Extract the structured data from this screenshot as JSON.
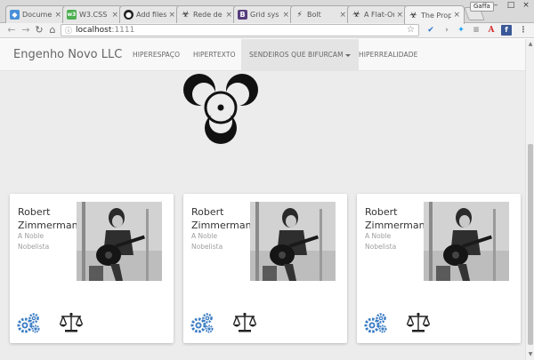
{
  "browser": {
    "tabs": [
      {
        "title": "Documen",
        "favicon_color": "#4a90d9",
        "favicon_glyph": "◆"
      },
      {
        "title": "W3.CSS",
        "favicon_color": "#4caf50",
        "favicon_glyph": "w3"
      },
      {
        "title": "Add files",
        "favicon_color": "#222222",
        "favicon_glyph": "●"
      },
      {
        "title": "Rede de",
        "favicon_color": "#555555",
        "favicon_glyph": "☣"
      },
      {
        "title": "Grid sys",
        "favicon_color": "#563d7c",
        "favicon_glyph": "B"
      },
      {
        "title": "Bolt",
        "favicon_color": "#333333",
        "favicon_glyph": "⚡"
      },
      {
        "title": "A Flat-Or",
        "favicon_color": "#555555",
        "favicon_glyph": "☣"
      },
      {
        "title": "The Prop",
        "favicon_color": "#555555",
        "favicon_glyph": "☣"
      }
    ],
    "profile_label": "Gaffa",
    "url_host": "localhost",
    "url_port": ":1111",
    "extension_icons": [
      "vpn-icon",
      "chevron-icon",
      "twitter-icon",
      "reader-icon",
      "acrobat-icon",
      "facebook-icon",
      "menu-icon"
    ]
  },
  "site": {
    "brand": "Engenho Novo LLC",
    "nav": [
      {
        "label": "HIPERESPAÇO"
      },
      {
        "label": "HIPERTEXTO"
      },
      {
        "label": "SENDEIROS QUE BIFURCAM"
      },
      {
        "label": "HIPERREALIDADE"
      }
    ],
    "cards": [
      {
        "name": "Robert Zimmerman",
        "subtitle": "A Noble Nobelista"
      },
      {
        "name": "Robert Zimmerman",
        "subtitle": "A Noble Nobelista"
      },
      {
        "name": "Robert Zimmerman",
        "subtitle": "A Noble Nobelista"
      }
    ],
    "colors": {
      "gear": "#3a7cc4",
      "scales": "#222222",
      "navbar": "#f8f8f8",
      "page_bg": "#ececec"
    }
  }
}
